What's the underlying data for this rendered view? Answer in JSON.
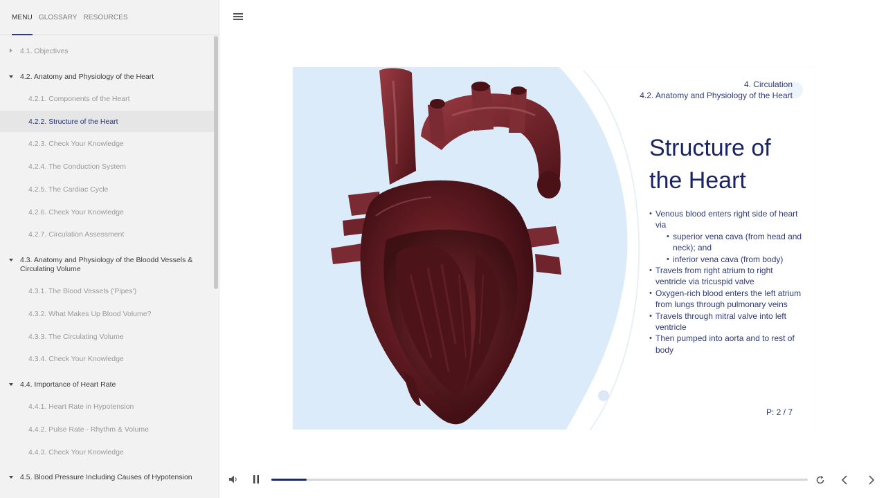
{
  "sidebar": {
    "tabs": [
      {
        "label": "MENU"
      },
      {
        "label": "GLOSSARY"
      },
      {
        "label": "RESOURCES"
      }
    ],
    "items": [
      {
        "label": "4.1. Objectives"
      },
      {
        "label": "4.2. Anatomy and Physiology of the Heart"
      },
      {
        "label": "4.2.1. Components of the Heart"
      },
      {
        "label": "4.2.2. Structure of the Heart"
      },
      {
        "label": "4.2.3. Check Your Knowledge"
      },
      {
        "label": "4.2.4. The Conduction System"
      },
      {
        "label": "4.2.5. The Cardiac Cycle"
      },
      {
        "label": "4.2.6. Check Your Knowledge"
      },
      {
        "label": "4.2.7. Circulation Assessment"
      },
      {
        "label": "4.3. Anatomy and Physiology of the Bloodd Vessels & Circulating Volume"
      },
      {
        "label": "4.3.1. The Blood Vessels ('Pipes')"
      },
      {
        "label": "4.3.2. What Makes Up Blood Volume?"
      },
      {
        "label": "4.3.3. The Circulating Volume"
      },
      {
        "label": "4.3.4. Check Your Knowledge"
      },
      {
        "label": "4.4. Importance of Heart Rate"
      },
      {
        "label": "4.4.1. Heart Rate in Hypotension"
      },
      {
        "label": "4.4.2. Pulse Rate - Rhythm & Volume"
      },
      {
        "label": "4.4.3. Check Your Knowledge"
      },
      {
        "label": "4.5. Blood Pressure Including Causes of Hypotension"
      }
    ]
  },
  "slide": {
    "course": "4. Circulation",
    "section": "4.2. Anatomy and Physiology of the Heart",
    "title_line1": "Structure of",
    "title_line2": "the Heart",
    "bullets": [
      "Venous blood enters right side of heart via",
      "superior vena cava (from head and neck); and",
      "inferior vena cava (from body)",
      "Travels from right atrium to right ventricle via tricuspid valve",
      "Oxygen-rich blood enters the left atrium from lungs through pulmonary veins",
      "Travels through mitral valve into left ventricle",
      "Then pumped into aorta and to rest of body"
    ],
    "page": "P: 2 / 7"
  },
  "player": {
    "progress_fraction": 0.066
  },
  "colors": {
    "accent": "#1c2a6b",
    "slide_text": "#2f3a78",
    "title_text": "#1b2463",
    "panel_blue": "#dcebf9",
    "heart_dark": "#5e1a20"
  },
  "icons": [
    "menu-icon",
    "volume-icon",
    "pause-icon",
    "replay-icon",
    "chevron-left-icon",
    "chevron-right-icon"
  ]
}
